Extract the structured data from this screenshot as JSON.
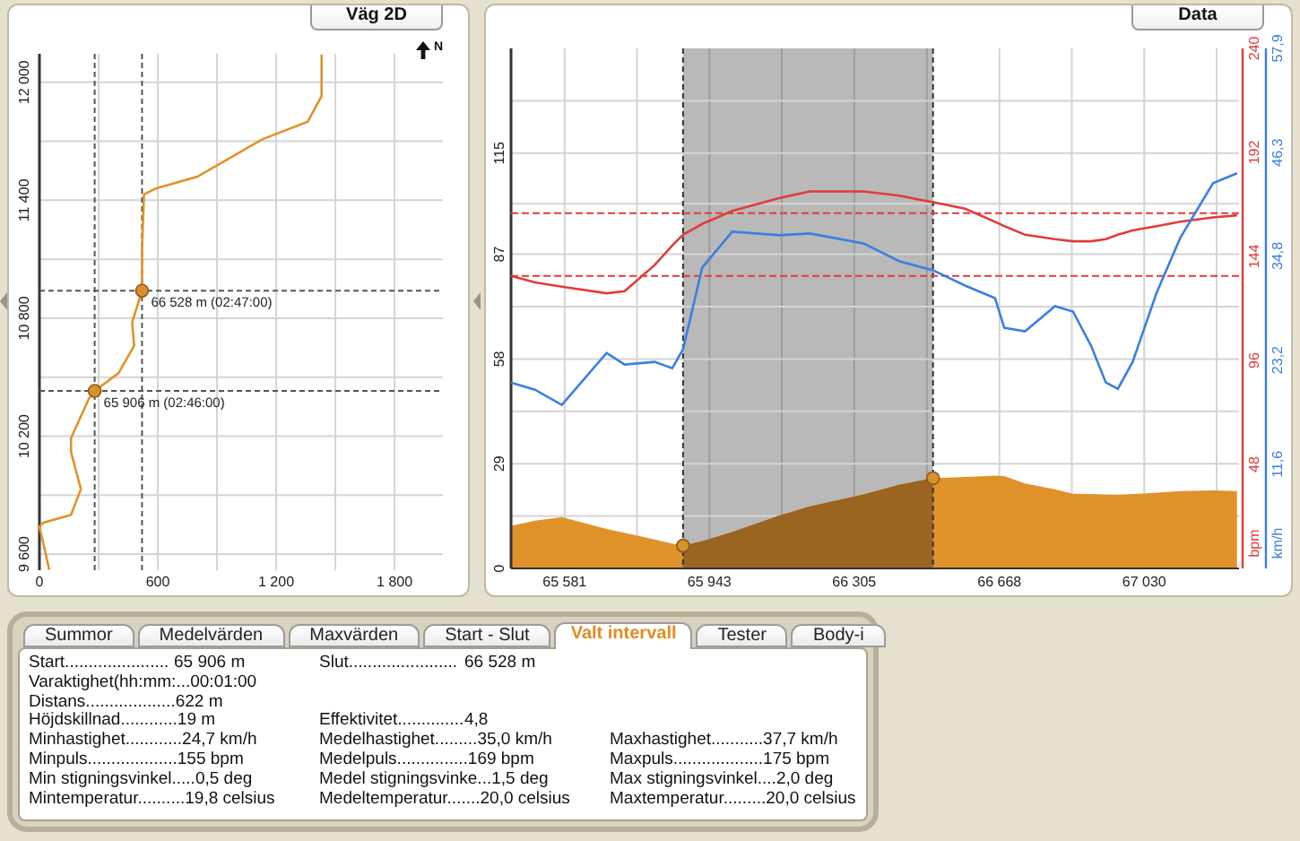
{
  "map_panel": {
    "title": "Väg 2D",
    "north_label": "N",
    "chart_data": {
      "type": "line",
      "grid": true,
      "xlim": [
        0,
        2045
      ],
      "ylim": [
        9518,
        12145
      ],
      "xticks": [
        {
          "value": 0,
          "label": "0"
        },
        {
          "value": 600,
          "label": "600"
        },
        {
          "value": 1200,
          "label": "1 200"
        },
        {
          "value": 1800,
          "label": "1 800"
        }
      ],
      "yticks": [
        {
          "value": 9600,
          "label": "9 600"
        },
        {
          "value": 10200,
          "label": "10 200"
        },
        {
          "value": 10800,
          "label": "10 800"
        },
        {
          "value": 11400,
          "label": "11 400"
        },
        {
          "value": 12000,
          "label": "12 000"
        }
      ],
      "x": [
        50,
        0,
        20,
        160,
        210,
        160,
        160,
        250,
        280,
        400,
        480,
        470,
        520,
        520,
        530,
        590,
        800,
        1130,
        1360,
        1430,
        1430
      ],
      "series": [
        {
          "color": "#e0922a",
          "values": [
            9520,
            9740,
            9760,
            9800,
            9930,
            10120,
            10190,
            10390,
            10430,
            10520,
            10660,
            10780,
            10940,
            11150,
            11430,
            11460,
            11520,
            11710,
            11800,
            11930,
            12140
          ]
        }
      ],
      "annotations": [
        {
          "text": "65 906 m (02:46:00)",
          "x": 280,
          "y": 10430
        },
        {
          "text": "66 528 m (02:47:00)",
          "x": 520,
          "y": 10940
        }
      ]
    }
  },
  "data_panel": {
    "title": "Data",
    "altitude": {
      "chart_data": {
        "type": "area",
        "grid": true,
        "xlim": [
          65447,
          67267
        ],
        "ylim": [
          0,
          144
        ],
        "xticks": [
          {
            "value": 65581,
            "label": "65 581"
          },
          {
            "value": 65943,
            "label": "65 943"
          },
          {
            "value": 66305,
            "label": "66 305"
          },
          {
            "value": 66668,
            "label": "66 668"
          },
          {
            "value": 67030,
            "label": "67 030"
          }
        ],
        "yticks": [
          0,
          29,
          58,
          87,
          115
        ],
        "x": [
          65447,
          65507,
          65574,
          65686,
          65731,
          65806,
          65850,
          65877,
          65925,
          66000,
          66119,
          66194,
          66328,
          66418,
          66502,
          66582,
          66657,
          66680,
          66732,
          66807,
          66852,
          66897,
          66934,
          66964,
          67001,
          67061,
          67120,
          67202,
          67262
        ],
        "series": [
          {
            "color": "#e0922a",
            "values": [
              11.8,
              13.2,
              14.2,
              10.9,
              9.9,
              8.0,
              6.9,
              6.3,
              7.6,
              10.1,
              14.7,
              17.2,
              20.5,
              23.2,
              25.0,
              25.3,
              25.7,
              25.6,
              23.5,
              21.9,
              20.7,
              20.6,
              20.5,
              20.4,
              20.6,
              21.0,
              21.4,
              21.6,
              21.4
            ]
          }
        ],
        "bands": [
          {
            "axis": "x",
            "from": 65877,
            "to": 66502
          }
        ]
      }
    },
    "pulse": {
      "chart_data": {
        "type": "line",
        "ylabel": "bpm",
        "xlim": [
          65447,
          67267
        ],
        "ylim": [
          0,
          240
        ],
        "yticks": [
          48,
          96,
          144,
          192,
          240
        ],
        "x": [
          65447,
          65507,
          65574,
          65686,
          65731,
          65806,
          65850,
          65877,
          65925,
          66000,
          66119,
          66194,
          66328,
          66418,
          66502,
          66582,
          66657,
          66680,
          66732,
          66807,
          66852,
          66897,
          66934,
          66964,
          67001,
          67061,
          67120,
          67202,
          67262
        ],
        "series": [
          {
            "color": "#e23b3b",
            "values": [
              135,
              132,
              130,
              127,
              128,
              140,
              149,
              154,
              159,
              165,
              171,
              174,
              174,
              172,
              169,
              166,
              160,
              158,
              154,
              152,
              151,
              151,
              152,
              154,
              156,
              158,
              160,
              162,
              163
            ]
          }
        ],
        "ref_lines": [
          {
            "axis": "y",
            "value": 164
          },
          {
            "axis": "y",
            "value": 135
          }
        ]
      }
    },
    "speed": {
      "chart_data": {
        "type": "line",
        "ylabel": "km/h",
        "xlim": [
          65447,
          67267
        ],
        "ylim": [
          0,
          57.9
        ],
        "yticks": [
          {
            "value": 11.6,
            "label": "11,6"
          },
          {
            "value": 23.2,
            "label": "23,2"
          },
          {
            "value": 34.8,
            "label": "34,8"
          },
          {
            "value": 46.3,
            "label": "46,3"
          },
          {
            "value": 57.9,
            "label": "57,9"
          }
        ],
        "x": [
          65447,
          65507,
          65574,
          65686,
          65731,
          65806,
          65850,
          65877,
          65925,
          66000,
          66119,
          66194,
          66328,
          66418,
          66502,
          66582,
          66657,
          66680,
          66732,
          66807,
          66852,
          66897,
          66934,
          66964,
          67001,
          67061,
          67120,
          67202,
          67262
        ],
        "series": [
          {
            "color": "#3b7fe0",
            "values": [
              20.7,
              19.9,
              18.2,
              24.0,
              22.7,
              23.0,
              22.3,
              24.4,
              33.5,
              37.5,
              37.1,
              37.3,
              36.2,
              34.2,
              33.2,
              31.5,
              30.1,
              26.8,
              26.4,
              29.2,
              28.6,
              24.8,
              20.7,
              20.0,
              23.0,
              30.7,
              36.8,
              42.9,
              44.0
            ]
          }
        ]
      }
    }
  },
  "stats_panel": {
    "tabs": [
      {
        "label": "Summor",
        "selected": false
      },
      {
        "label": "Medelvärden",
        "selected": false
      },
      {
        "label": "Maxvärden",
        "selected": false
      },
      {
        "label": "Start - Slut",
        "selected": false
      },
      {
        "label": "Valt intervall",
        "selected": true
      },
      {
        "label": "Tester",
        "selected": false
      },
      {
        "label": "Body-i",
        "selected": false
      }
    ],
    "rows": [
      {
        "col_1": {
          "label": "Start......................",
          "value": "65 906 m"
        },
        "col_2": {
          "label": "Slut.......................",
          "value": "66 528 m"
        }
      },
      {
        "col_1": {
          "label": "Varaktighet(hh:mm:...",
          "value": "00:01:00"
        }
      },
      {
        "col_1": {
          "label": "Distans...................",
          "value": "622 m"
        }
      },
      {
        "col_1": {
          "label": "Höjdskillnad............",
          "value": "19 m"
        },
        "col_2": {
          "label": "Effektivitet..............",
          "value": "4,8"
        }
      },
      {
        "col_1": {
          "label": "Minhastighet............",
          "value": "24,7 km/h"
        },
        "col_2": {
          "label": "Medelhastighet.........",
          "value": "35,0 km/h"
        },
        "col_3": {
          "label": "Maxhastighet...........",
          "value": "37,7 km/h"
        }
      },
      {
        "col_1": {
          "label": "Minpuls...................",
          "value": "155 bpm"
        },
        "col_2": {
          "label": "Medelpuls...............",
          "value": "169 bpm"
        },
        "col_3": {
          "label": "Maxpuls...................",
          "value": "175 bpm"
        }
      },
      {
        "col_1": {
          "label": "Min stigningsvinkel.....",
          "value": "0,5 deg"
        },
        "col_2": {
          "label": "Medel stigningsvinke...",
          "value": "1,5 deg"
        },
        "col_3": {
          "label": "Max stigningsvinkel....",
          "value": "2,0 deg"
        }
      },
      {
        "col_1": {
          "label": "Mintemperatur..........",
          "value": "19,8 celsius"
        },
        "col_2": {
          "label": "Medeltemperatur.......",
          "value": "20,0 celsius"
        },
        "col_3": {
          "label": "Maxtemperatur.........",
          "value": "20,0 celsius"
        }
      }
    ]
  }
}
